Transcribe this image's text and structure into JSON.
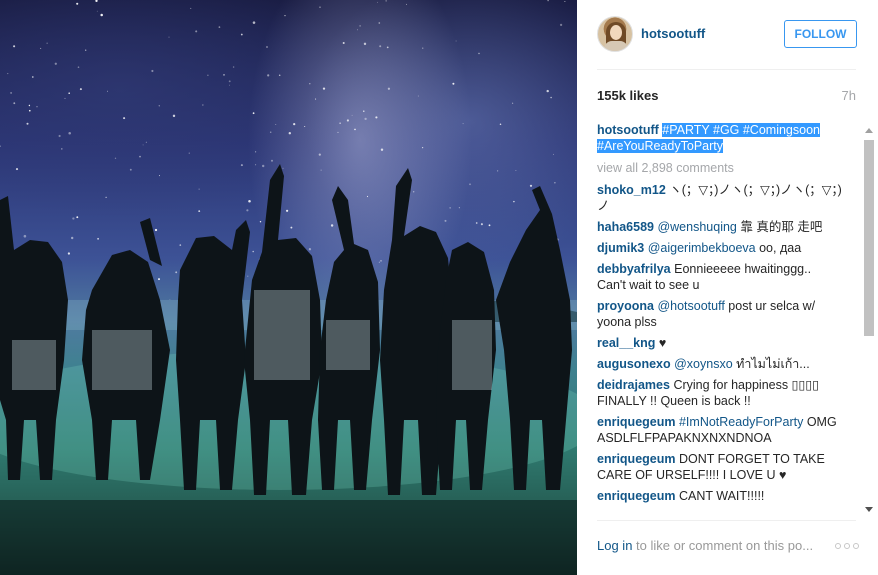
{
  "header": {
    "username": "hotsootuff",
    "follow_label": "FOLLOW"
  },
  "stats": {
    "likes": "155k likes",
    "time": "7h"
  },
  "caption": {
    "user": "hotsootuff",
    "hashtags": "#PARTY #GG #Comingsoon #AreYouReadyToParty"
  },
  "view_all": "view all 2,898 comments",
  "comments": [
    {
      "user": "shoko_m12",
      "mention": "",
      "text": "ヽ(；▽；)ノヽ(；▽；)ノヽ(；▽；)ノ"
    },
    {
      "user": "haha6589",
      "mention": "@wenshuqing",
      "text": "靠 真的耶 走吧"
    },
    {
      "user": "djumik3",
      "mention": "@aigerimbekboeva",
      "text": "оо, даа"
    },
    {
      "user": "debbyafrilya",
      "mention": "",
      "text": "Eonnieeeee hwaitinggg.. Can't wait to see u"
    },
    {
      "user": "proyoona",
      "mention": "@hotsootuff",
      "text": "post ur selca w/ yoona plss"
    },
    {
      "user": "real__kng",
      "mention": "",
      "text": "♥"
    },
    {
      "user": "augusonexo",
      "mention": "@xoynsxo",
      "text": "ทำไมไม่เก้า..."
    },
    {
      "user": "deidrajames",
      "mention": "",
      "text": "Crying for happiness ▯▯▯▯ FINALLY !! Queen is back !!"
    },
    {
      "user": "enriquegeum",
      "mention": "#ImNotReadyForParty",
      "text": "OMG ASDLFLFPAPAKNXNXNDNOA"
    },
    {
      "user": "enriquegeum",
      "mention": "",
      "text": "DONT FORGET TO TAKE CARE OF URSELF!!!! I LOVE U ♥"
    },
    {
      "user": "enriquegeum",
      "mention": "",
      "text": "CANT WAIT!!!!!"
    }
  ],
  "footer": {
    "login_link": "Log in",
    "login_rest": "to like or comment on this po..."
  },
  "icons": {
    "more": "more-options-icon",
    "avatar": "profile-avatar"
  },
  "colors": {
    "link": "#125688",
    "follow": "#3897f0",
    "muted": "#a5a7aa"
  }
}
